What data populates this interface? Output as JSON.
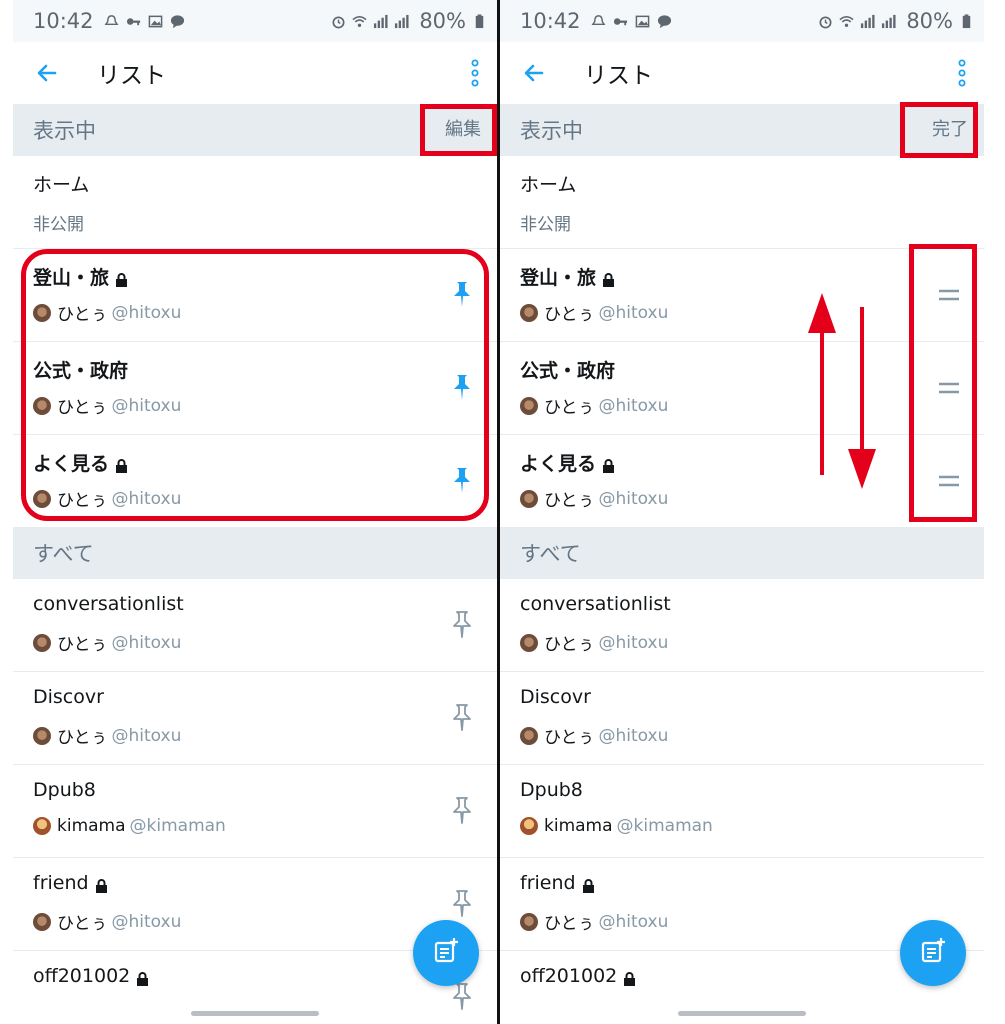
{
  "status": {
    "time": "10:42",
    "battery": "80%"
  },
  "header": {
    "title": "リスト"
  },
  "sections": {
    "shown": "表示中",
    "all": "すべて"
  },
  "actions": {
    "edit": "編集",
    "done": "完了"
  },
  "home": {
    "title": "ホーム",
    "visibility": "非公開"
  },
  "pinned": [
    {
      "title": "登山・旅",
      "locked": true,
      "owner": "ひとぅ",
      "handle": "@hitoxu"
    },
    {
      "title": "公式・政府",
      "locked": false,
      "owner": "ひとぅ",
      "handle": "@hitoxu"
    },
    {
      "title": "よく見る",
      "locked": true,
      "owner": "ひとぅ",
      "handle": "@hitoxu"
    }
  ],
  "all_lists": [
    {
      "title": "conversationlist",
      "locked": false,
      "owner": "ひとぅ",
      "handle": "@hitoxu"
    },
    {
      "title": "Discovr",
      "locked": false,
      "owner": "ひとぅ",
      "handle": "@hitoxu"
    },
    {
      "title": "Dpub8",
      "locked": false,
      "owner": "kimama",
      "handle": "@kimaman"
    },
    {
      "title": "friend",
      "locked": true,
      "owner": "ひとぅ",
      "handle": "@hitoxu"
    },
    {
      "title": "off201002",
      "locked": true,
      "owner": "",
      "handle": ""
    }
  ],
  "colors": {
    "accent": "#1da1f2",
    "highlight": "#e4001b",
    "section_bg": "#e6ecf0",
    "page_bg": "#f5f8fa"
  }
}
